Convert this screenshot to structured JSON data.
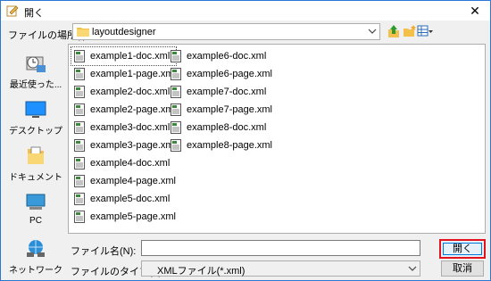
{
  "window": {
    "title": "開く",
    "close_glyph": "✕"
  },
  "lookin": {
    "label": "ファイルの場所(I):",
    "value": "layoutdesigner"
  },
  "toolbar": {
    "icons": [
      "up-folder-icon",
      "new-folder-icon",
      "view-menu-icon"
    ]
  },
  "places": [
    {
      "label": "最近使った...",
      "icon": "recent-places-icon"
    },
    {
      "label": "デスクトップ",
      "icon": "desktop-icon"
    },
    {
      "label": "ドキュメント",
      "icon": "documents-icon"
    },
    {
      "label": "PC",
      "icon": "pc-icon"
    },
    {
      "label": "ネットワーク",
      "icon": "network-icon"
    }
  ],
  "files": {
    "col1": [
      "example1-doc.xml",
      "example1-page.xml",
      "example2-doc.xml",
      "example2-page.xml",
      "example3-doc.xml",
      "example3-page.xml",
      "example4-doc.xml",
      "example4-page.xml",
      "example5-doc.xml",
      "example5-page.xml"
    ],
    "col2": [
      "example6-doc.xml",
      "example6-page.xml",
      "example7-doc.xml",
      "example7-page.xml",
      "example8-doc.xml",
      "example8-page.xml"
    ]
  },
  "filename": {
    "label": "ファイル名(N):",
    "value": ""
  },
  "filetype": {
    "label": "ファイルのタイプ(T):",
    "value": "XMLファイル(*.xml)"
  },
  "buttons": {
    "open": "開く",
    "cancel": "取消"
  },
  "colors": {
    "accent": "#0078d7",
    "highlight": "#e4121c",
    "folder": "#f3c04c"
  }
}
